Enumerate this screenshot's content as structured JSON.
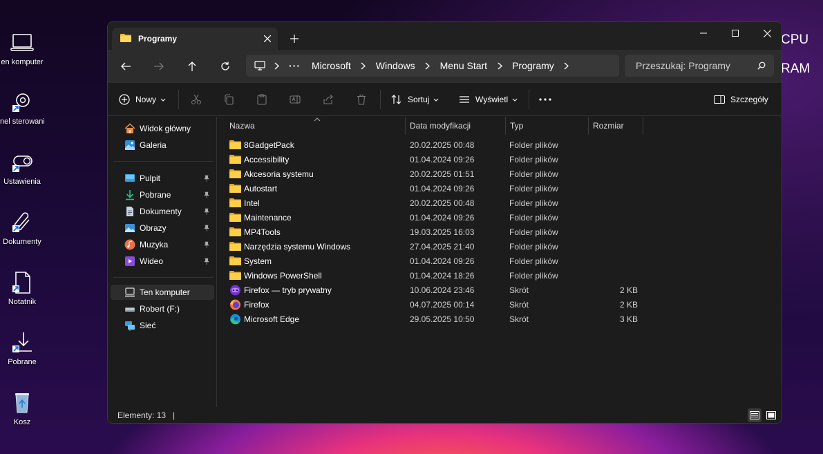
{
  "desktop": {
    "icons": [
      {
        "label": "en komputer",
        "icon": "computer-icon"
      },
      {
        "label": "nel sterowania",
        "icon": "control-panel-icon"
      },
      {
        "label": "Ustawienia",
        "icon": "settings-icon"
      },
      {
        "label": "Dokumenty",
        "icon": "documents-icon"
      },
      {
        "label": "Notatnik",
        "icon": "notepad-icon"
      },
      {
        "label": "Pobrane",
        "icon": "downloads-icon"
      },
      {
        "label": "Kosz",
        "icon": "recycle-bin-icon"
      }
    ],
    "overlay": [
      "CPU",
      "RAM"
    ]
  },
  "window": {
    "tab_title": "Programy",
    "breadcrumb": [
      "Microsoft",
      "Windows",
      "Menu Start",
      "Programy"
    ],
    "search_placeholder": "Przeszukaj: Programy",
    "toolbar": {
      "new_label": "Nowy",
      "sort_label": "Sortuj",
      "view_label": "Wyświetl",
      "details_label": "Szczegóły"
    },
    "sidebar": {
      "top": [
        {
          "label": "Widok główny",
          "icon": "home-icon"
        },
        {
          "label": "Galeria",
          "icon": "gallery-icon"
        }
      ],
      "pinned": [
        {
          "label": "Pulpit",
          "icon": "desktop-icon"
        },
        {
          "label": "Pobrane",
          "icon": "download-icon"
        },
        {
          "label": "Dokumenty",
          "icon": "document-icon"
        },
        {
          "label": "Obrazy",
          "icon": "pictures-icon"
        },
        {
          "label": "Muzyka",
          "icon": "music-icon"
        },
        {
          "label": "Wideo",
          "icon": "video-icon"
        }
      ],
      "bottom": [
        {
          "label": "Ten komputer",
          "icon": "this-pc-icon"
        },
        {
          "label": "Robert (F:)",
          "icon": "drive-icon"
        },
        {
          "label": "Sieć",
          "icon": "network-icon"
        }
      ]
    },
    "columns": {
      "name": "Nazwa",
      "date": "Data modyfikacji",
      "type": "Typ",
      "size": "Rozmiar"
    },
    "files": [
      {
        "name": "8GadgetPack",
        "date": "20.02.2025 00:48",
        "type": "Folder plików",
        "size": "",
        "icon": "folder"
      },
      {
        "name": "Accessibility",
        "date": "01.04.2024 09:26",
        "type": "Folder plików",
        "size": "",
        "icon": "folder"
      },
      {
        "name": "Akcesoria systemu",
        "date": "20.02.2025 01:51",
        "type": "Folder plików",
        "size": "",
        "icon": "folder"
      },
      {
        "name": "Autostart",
        "date": "01.04.2024 09:26",
        "type": "Folder plików",
        "size": "",
        "icon": "folder"
      },
      {
        "name": "Intel",
        "date": "20.02.2025 00:48",
        "type": "Folder plików",
        "size": "",
        "icon": "folder"
      },
      {
        "name": "Maintenance",
        "date": "01.04.2024 09:26",
        "type": "Folder plików",
        "size": "",
        "icon": "folder"
      },
      {
        "name": "MP4Tools",
        "date": "19.03.2025 16:03",
        "type": "Folder plików",
        "size": "",
        "icon": "folder"
      },
      {
        "name": "Narzędzia systemu Windows",
        "date": "27.04.2025 21:40",
        "type": "Folder plików",
        "size": "",
        "icon": "folder"
      },
      {
        "name": "System",
        "date": "01.04.2024 09:26",
        "type": "Folder plików",
        "size": "",
        "icon": "folder"
      },
      {
        "name": "Windows PowerShell",
        "date": "01.04.2024 18:26",
        "type": "Folder plików",
        "size": "",
        "icon": "folder"
      },
      {
        "name": "Firefox — tryb prywatny",
        "date": "10.06.2024 23:46",
        "type": "Skrót",
        "size": "2 KB",
        "icon": "firefox-private"
      },
      {
        "name": "Firefox",
        "date": "04.07.2025 00:14",
        "type": "Skrót",
        "size": "2 KB",
        "icon": "firefox"
      },
      {
        "name": "Microsoft Edge",
        "date": "29.05.2025 10:50",
        "type": "Skrót",
        "size": "3 KB",
        "icon": "edge"
      }
    ],
    "status": "Elementy: 13"
  }
}
